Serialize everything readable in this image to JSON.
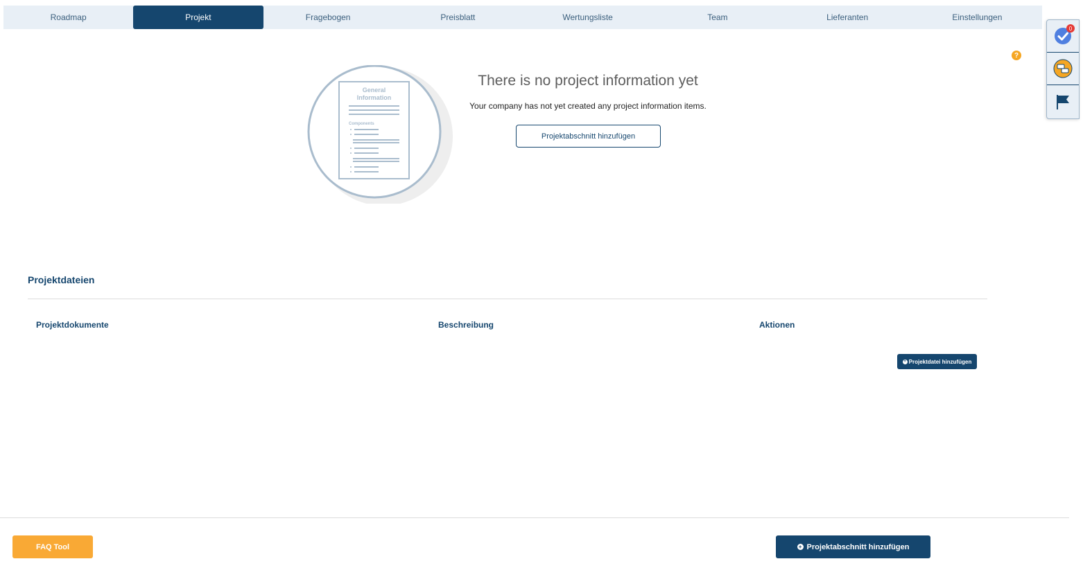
{
  "nav": {
    "tabs": [
      {
        "label": "Roadmap"
      },
      {
        "label": "Projekt",
        "active": true
      },
      {
        "label": "Fragebogen"
      },
      {
        "label": "Preisblatt"
      },
      {
        "label": "Wertungsliste"
      },
      {
        "label": "Team"
      },
      {
        "label": "Lieferanten"
      },
      {
        "label": "Einstellungen"
      }
    ]
  },
  "side_toolbar": {
    "tasks_badge": "0",
    "icons": [
      "check-circle-icon",
      "chat-icon",
      "flag-icon"
    ]
  },
  "help": {
    "glyph": "?"
  },
  "empty_state": {
    "illustration": {
      "doc_title_line1": "General",
      "doc_title_line2": "Information",
      "doc_section": "Components"
    },
    "title": "There is no project information yet",
    "subtitle": "Your company has not yet created any project information items.",
    "add_button": "Projektabschnitt hinzufügen"
  },
  "files": {
    "title": "Projektdateien",
    "columns": [
      "Projektdokumente",
      "Beschreibung",
      "Aktionen"
    ],
    "add_file_button": "Projektdatei hinzufügen"
  },
  "footer": {
    "faq_button": "FAQ Tool",
    "add_section_button": "Projektabschnitt hinzufügen"
  },
  "colors": {
    "primary": "#15466e",
    "accent": "#f9a935",
    "nav_bg": "#e8eff6",
    "badge": "#e53935"
  }
}
